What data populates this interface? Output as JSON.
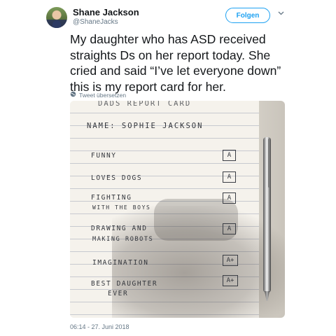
{
  "author": {
    "name": "Shane Jackson",
    "handle": "@ShaneJacks"
  },
  "actions": {
    "follow_label": "Folgen",
    "menu_icon": "chevron-down-icon"
  },
  "tweet": {
    "text": "My daughter who has ASD received straights Ds on her report today. She cried and said “I’ve let everyone down” this is my report card for her.",
    "translate_label": "Tweet übersetzen",
    "translate_icon": "globe-icon",
    "timestamp": "06:14 - 27. Juni 2018"
  },
  "photo": {
    "header": "DADS REPORT CARD",
    "name_line": "NAME: SOPHIE JACKSON",
    "items": [
      {
        "line1": "FUNNY",
        "line2": "",
        "grade": "A"
      },
      {
        "line1": "LOVES DOGS",
        "line2": "",
        "grade": "A"
      },
      {
        "line1": "FIGHTING",
        "line2": "WITH THE BOYS",
        "grade": "A"
      },
      {
        "line1": "DRAWING AND",
        "line2": "MAKING ROBOTS",
        "grade": "A"
      },
      {
        "line1": "IMAGINATION",
        "line2": "",
        "grade": "A+"
      },
      {
        "line1": "BEST DAUGHTER",
        "line2": "EVER",
        "grade": "A+"
      }
    ]
  },
  "colors": {
    "accent": "#1da1f2",
    "text": "#14171a",
    "secondary": "#657786"
  }
}
